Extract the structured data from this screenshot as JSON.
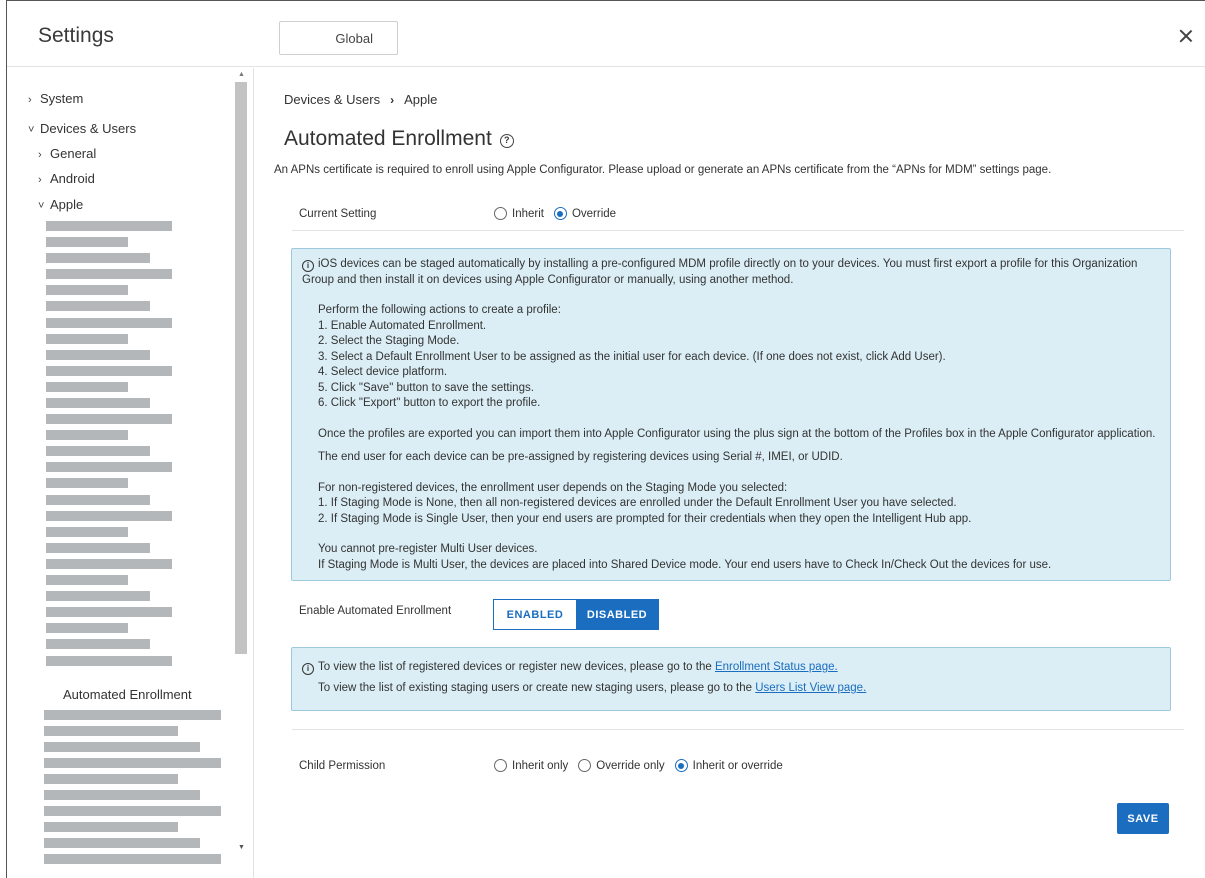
{
  "header": {
    "title": "Settings",
    "scope_button": "Global"
  },
  "sidebar": {
    "items": [
      {
        "label": "System",
        "expanded": false
      },
      {
        "label": "Devices & Users",
        "expanded": true
      },
      {
        "label": "General",
        "expanded": false
      },
      {
        "label": "Android",
        "expanded": false
      },
      {
        "label": "Apple",
        "expanded": true
      }
    ],
    "selected_label": "Automated Enrollment"
  },
  "breadcrumb": {
    "parent": "Devices & Users",
    "current": "Apple"
  },
  "page": {
    "title": "Automated Enrollment",
    "subtitle": "An APNs certificate is required to enroll using Apple Configurator. Please upload or generate an APNs certificate from the “APNs for MDM” settings page."
  },
  "current_setting": {
    "label": "Current Setting",
    "options": [
      "Inherit",
      "Override"
    ],
    "selected": "Override"
  },
  "info_box": {
    "intro": "iOS devices can be staged automatically by installing a pre-configured MDM profile directly on to your devices. You must first export a profile for this Organization Group and then install it on devices using Apple Configurator or manually, using another method.",
    "steps_header": "Perform the following actions to create a profile:",
    "steps": [
      "1. Enable Automated Enrollment.",
      "2. Select the Staging Mode.",
      "3. Select a Default Enrollment User to be assigned as the initial user for each device. (If one does not exist, click Add User).",
      "4. Select device platform.",
      "5. Click \"Save\" button to save the settings.",
      "6. Click \"Export\" button to export the profile."
    ],
    "import_note": "Once the profiles are exported you can import them into Apple Configurator using the plus sign at the bottom of the Profiles box in the Apple Configurator application.",
    "preassign_note": "The end user for each device can be pre-assigned by registering devices using Serial #, IMEI, or UDID.",
    "nonreg_header": "For non-registered devices, the enrollment user depends on the Staging Mode you selected:",
    "nonreg_items": [
      "1. If Staging Mode is None, then all non-registered devices are enrolled under the Default Enrollment User you have selected.",
      "2. If Staging Mode is Single User, then your end users are prompted for their credentials when they open the Intelligent Hub app."
    ],
    "multi_1": "You cannot pre-register Multi User devices.",
    "multi_2": "If Staging Mode is Multi User, the devices are placed into Shared Device mode. Your end users have to Check In/Check Out the devices for use."
  },
  "enable": {
    "label": "Enable Automated Enrollment",
    "enabled_label": "ENABLED",
    "disabled_label": "DISABLED",
    "selected": "DISABLED"
  },
  "links_box": {
    "line1_prefix": "To view the list of registered devices or register new devices, please go to the ",
    "line1_link": "Enrollment Status page.",
    "line2_prefix": "To view the list of existing staging users or create new staging users, please go to the ",
    "line2_link": "Users List View page."
  },
  "child_permission": {
    "label": "Child Permission",
    "options": [
      "Inherit only",
      "Override only",
      "Inherit or override"
    ],
    "selected": "Inherit or override"
  },
  "save_label": "SAVE"
}
